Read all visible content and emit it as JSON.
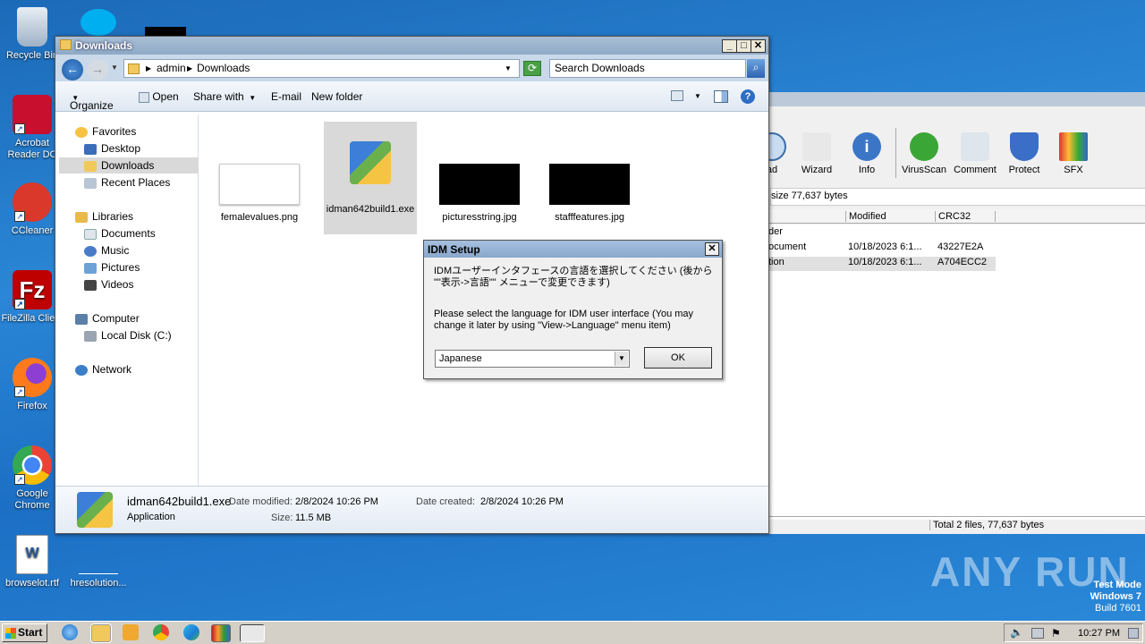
{
  "desktop": {
    "icons": [
      {
        "label": "Recycle Bin",
        "color": "#cfd8e3"
      },
      {
        "label": "Acrobat Reader DC",
        "color": "#c8102e"
      },
      {
        "label": "CCleaner",
        "color": "#d9382a"
      },
      {
        "label": "FileZilla Client",
        "color": "#bf0000"
      },
      {
        "label": "Firefox",
        "color": "#ff7a1a"
      },
      {
        "label": "Google Chrome",
        "color": "#2a9d48"
      },
      {
        "label": "browselot.rtf",
        "color": "#2b5797"
      },
      {
        "label": "hresolution...",
        "color": "#2a86d6"
      }
    ],
    "watermark": "ANY RUN",
    "os_text": {
      "mode": "Test Mode",
      "os": "Windows 7",
      "build": "Build 7601"
    }
  },
  "bg_app": {
    "toolbar": [
      "ad",
      "Wizard",
      "Info",
      "VirusScan",
      "Comment",
      "Protect",
      "SFX"
    ],
    "size_line": "size 77,637 bytes",
    "columns": [
      "Modified",
      "CRC32"
    ],
    "rows": [
      {
        "name": "der",
        "modified": "",
        "crc": ""
      },
      {
        "name": "ocument",
        "modified": "10/18/2023 6:1...",
        "crc": "43227E2A"
      },
      {
        "name": "tion",
        "modified": "10/18/2023 6:1...",
        "crc": "A704ECC2"
      }
    ],
    "status": "Total 2 files, 77,637 bytes"
  },
  "explorer": {
    "title": "Downloads",
    "breadcrumb": [
      "admin",
      "Downloads"
    ],
    "search_placeholder": "Search Downloads",
    "commands": [
      "Organize",
      "Open",
      "Share with",
      "E-mail",
      "New folder"
    ],
    "nav": {
      "favorites": "Favorites",
      "favorites_items": [
        "Desktop",
        "Downloads",
        "Recent Places"
      ],
      "libraries": "Libraries",
      "libraries_items": [
        "Documents",
        "Music",
        "Pictures",
        "Videos"
      ],
      "computer": "Computer",
      "computer_items": [
        "Local Disk (C:)"
      ],
      "network": "Network"
    },
    "files": [
      {
        "name": "femalevalues.png"
      },
      {
        "name": "idman642build1.exe"
      },
      {
        "name": "picturesstring.jpg"
      },
      {
        "name": "stafffeatures.jpg"
      }
    ],
    "details": {
      "name": "idman642build1.exe",
      "type": "Application",
      "modified_label": "Date modified:",
      "modified": "2/8/2024 10:26 PM",
      "created_label": "Date created:",
      "created": "2/8/2024 10:26 PM",
      "size_label": "Size:",
      "size": "11.5 MB"
    }
  },
  "dialog": {
    "title": "IDM Setup",
    "text_jp": "IDMユーザーインタフェースの言語を選択してください (後から \"\"表示->言語\"\" メニューで変更できます)",
    "text_en": "Please select the language for IDM user interface (You may change it later by using \"View->Language\" menu item)",
    "language": "Japanese",
    "ok": "OK"
  },
  "taskbar": {
    "start": "Start",
    "time": "10:27 PM"
  }
}
